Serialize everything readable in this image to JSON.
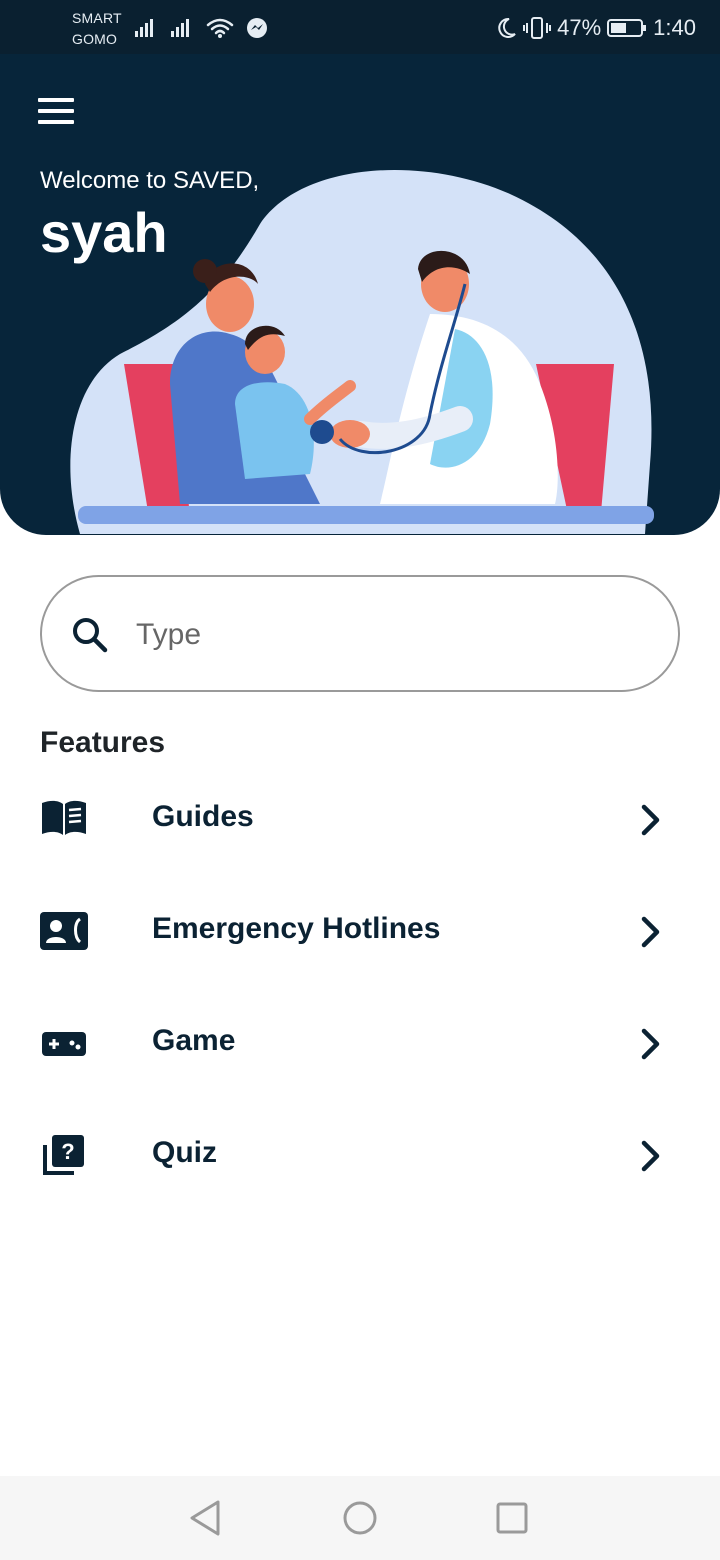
{
  "status_bar": {
    "carrier_line1": "SMART",
    "carrier_line2": "GOMO",
    "battery": "47%",
    "time": "1:40"
  },
  "header": {
    "welcome": "Welcome to SAVED,",
    "username": "syah"
  },
  "search": {
    "placeholder": "Type"
  },
  "features": {
    "title": "Features",
    "items": [
      {
        "label": "Guides",
        "icon": "book-icon"
      },
      {
        "label": "Emergency Hotlines",
        "icon": "contact-phone-icon"
      },
      {
        "label": "Game",
        "icon": "gamepad-icon"
      },
      {
        "label": "Quiz",
        "icon": "quiz-icon"
      }
    ]
  },
  "colors": {
    "header_bg": "#07253a",
    "status_bg": "#0a2030",
    "text_dark": "#0b2233",
    "blob": "#d4e2f8"
  }
}
